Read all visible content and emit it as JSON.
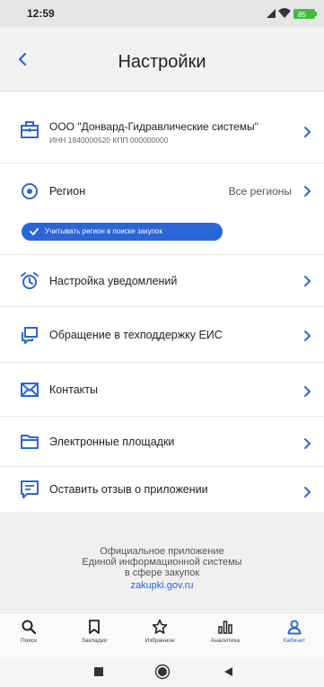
{
  "status_bar": {
    "time": "12:59",
    "battery": "85"
  },
  "header": {
    "title": "Настройки",
    "back_icon": "chevron-left-icon"
  },
  "settings": {
    "organization": {
      "name": "ООО \"Донвард-Гидравлические системы\"",
      "details": "ИНН 1840000520 КПП 000000000",
      "icon": "building-icon"
    },
    "region": {
      "label": "Регион",
      "value": "Все регионы",
      "icon": "location-pin-icon",
      "chip_label": "Учитывать регион в поиске закупок",
      "chip_checked": true
    },
    "notifications": {
      "label": "Настройка уведомлений",
      "icon": "alarm-clock-icon"
    },
    "support": {
      "label": "Обращение в техподдержку ЕИС",
      "icon": "chat-icon"
    },
    "contacts": {
      "label": "Контакты",
      "icon": "envelope-icon"
    },
    "platforms": {
      "label": "Электронные площадки",
      "icon": "folder-icon"
    },
    "feedback": {
      "label": "Оставить отзыв о приложении",
      "icon": "feedback-icon"
    }
  },
  "footer": {
    "line1": "Официальное приложение",
    "line2": "Единой информационной системы",
    "line3": "в сфере закупок",
    "link": "zakupki.gov.ru"
  },
  "bottom_nav": {
    "search": "Поиск",
    "bookmarks": "Закладки",
    "favorites": "Избранное",
    "analytics": "Аналитика",
    "cabinet": "Кабинет",
    "active": "cabinet"
  },
  "colors": {
    "accent": "#2a66d9",
    "background": "#ffffff",
    "footer_bg": "#f0f0f0"
  }
}
